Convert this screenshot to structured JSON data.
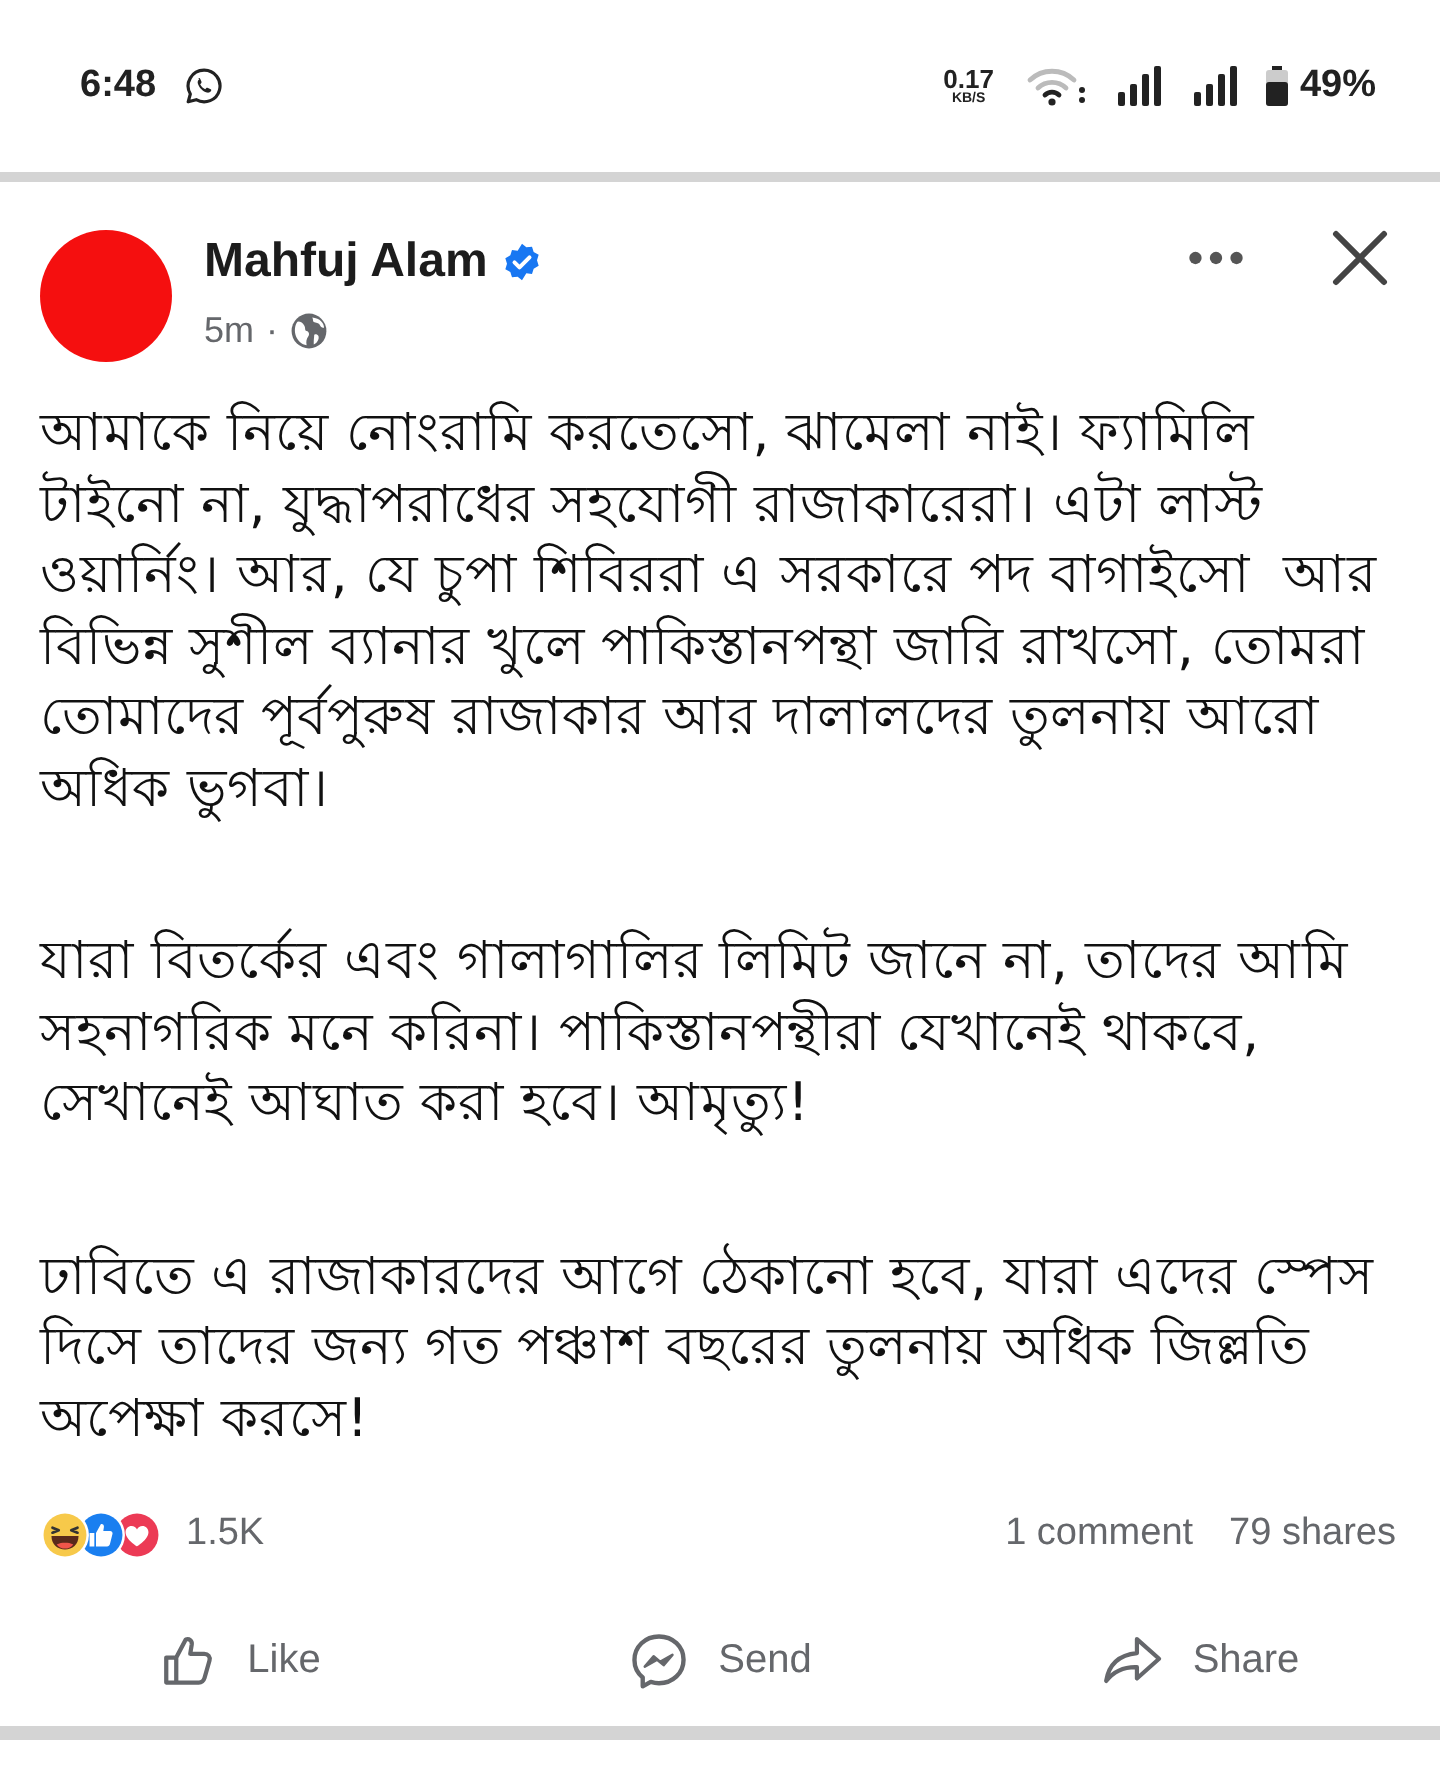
{
  "status_bar": {
    "time": "6:48",
    "speed_value": "0.17",
    "speed_unit": "KB/S",
    "battery": "49%"
  },
  "post": {
    "author": "Mahfuj Alam",
    "verified": true,
    "time": "5m",
    "separator": "·",
    "paragraphs": [
      "আমাকে নিয়ে নোংরামি করতেসো, ঝামেলা নাই। ফ্যামিলি\nটাইনো না, যুদ্ধাপরাধের সহযোগী রাজাকারেরা। এটা লাস্ট\nওয়ার্নিং। আর, যে চুপা শিবিররা এ সরকারে পদ বাগাইসো  আর\nবিভিন্ন সুশীল ব্যানার খুলে পাকিস্তানপন্থা জারি রাখসো, তোমরা\nতোমাদের পূর্বপুরুষ রাজাকার আর দালালদের তুলনায় আরো\nঅধিক ভুগবা।",
      "যারা বিতর্কের এবং গালাগালির লিমিট জানে না, তাদের আমি\nসহনাগরিক মনে করিনা। পাকিস্তানপন্থীরা যেখানেই থাকবে,\nসেখানেই আঘাত করা হবে। আমৃত্যু!",
      "ঢাবিতে এ রাজাকারদের আগে ঠেকানো হবে, যারা এদের স্পেস\nদিসে তাদের জন্য গত পঞ্চাশ বছরের তুলনায় অধিক জিল্লতি\nঅপেক্ষা করসে!"
    ]
  },
  "reactions": {
    "types": [
      {
        "kind": "haha"
      },
      {
        "kind": "like"
      },
      {
        "kind": "love"
      }
    ],
    "count": "1.5K",
    "comments": "1 comment",
    "shares": "79 shares"
  },
  "actions": [
    {
      "kind": "like",
      "label": "Like"
    },
    {
      "kind": "send",
      "label": "Send"
    },
    {
      "kind": "share",
      "label": "Share"
    }
  ]
}
